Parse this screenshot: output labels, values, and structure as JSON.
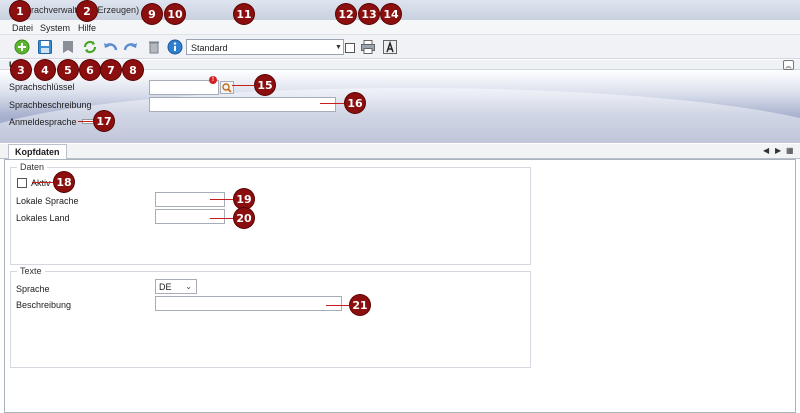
{
  "window": {
    "title": "Sprachverwaltung (Erzeugen)"
  },
  "menu": {
    "items": [
      "Datei",
      "System",
      "Hilfe"
    ]
  },
  "toolbar": {
    "layout_select_value": "Standard"
  },
  "section": {
    "label": "U"
  },
  "header_form": {
    "sprachschluessel_label": "Sprachschlüssel",
    "sprachschluessel_value": "",
    "sprachbeschreibung_label": "Sprachbeschreibung",
    "sprachbeschreibung_value": "",
    "anmeldesprache_label": "Anmeldesprache"
  },
  "tabs": {
    "active": "Kopfdaten"
  },
  "daten": {
    "title": "Daten",
    "aktiv_label": "Aktiv",
    "lokale_sprache_label": "Lokale Sprache",
    "lokale_sprache_value": "",
    "lokales_land_label": "Lokales Land",
    "lokales_land_value": ""
  },
  "texte": {
    "title": "Texte",
    "sprache_label": "Sprache",
    "sprache_value": "DE",
    "beschreibung_label": "Beschreibung",
    "beschreibung_value": ""
  },
  "callouts": [
    "1",
    "2",
    "3",
    "4",
    "5",
    "6",
    "7",
    "8",
    "9",
    "10",
    "11",
    "12",
    "13",
    "14",
    "15",
    "16",
    "17",
    "18",
    "19",
    "20",
    "21"
  ],
  "colors": {
    "callout": "#8b0f0f",
    "callout_line": "#c81e1e",
    "header_band": "#8e98bb"
  }
}
